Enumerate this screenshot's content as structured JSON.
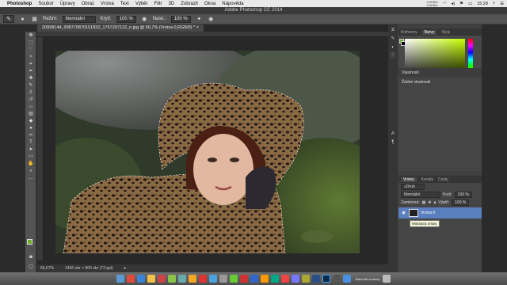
{
  "menubar": {
    "apple": "",
    "items": [
      "Photoshop",
      "Soubor",
      "Úpravy",
      "Obraz",
      "Vrstva",
      "Text",
      "Výběr",
      "Filtr",
      "3D",
      "Zobrazit",
      "Okna",
      "Nápověda"
    ],
    "net_up": "0,0KB/s",
    "net_down": "0,0KB/s",
    "clock": "15:29"
  },
  "window": {
    "title": "Adobe Photoshop CC 2014"
  },
  "options": {
    "rezim_label": "Režim:",
    "rezim_value": "Normální",
    "kryti_label": "Krytí:",
    "kryti_value": "100 %",
    "nask_label": "Nask.:",
    "nask_value": "100 %"
  },
  "document": {
    "tab": "20998144_998770870151832_1767297122_n.jpg @ 66,7% (Vrstva 0,RGB/8) *",
    "zoom": "66,67%",
    "info": "1436 obr × 960 obr (72 ppi)"
  },
  "color_panel": {
    "tabs": [
      "Knihovny",
      "Barvy",
      "Styly"
    ],
    "active": "Barvy",
    "fg": "#6fae2a",
    "bg": "#000000"
  },
  "properties": {
    "title": "Vlastnosti",
    "subtitle": "Žádné vlastnosti"
  },
  "layers": {
    "tabs": [
      "Vrstvy",
      "Kanály",
      "Cesty"
    ],
    "active": "Vrstvy",
    "filter": "Druh",
    "blend": "Normální",
    "opacity_label": "Krytí:",
    "opacity": "100 %",
    "lock_label": "Zamknout:",
    "fill_label": "Výplň:",
    "fill": "100 %",
    "layer_name": "Vrstva 0",
    "tooltip": "Miniatura vrstvy"
  },
  "dock": {
    "label": "Stáhnuté soubory"
  }
}
